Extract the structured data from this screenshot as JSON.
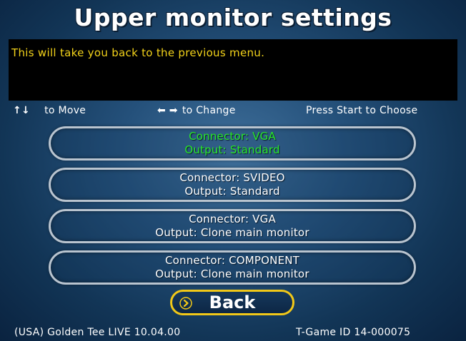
{
  "title": "Upper monitor settings",
  "help_text": "This will take you back to the previous menu.",
  "hints": {
    "move_arrows": "↑↓",
    "move_label": "to Move",
    "change_arrows": "⬅ ➡",
    "change_label": "to Change",
    "start_label": "Press Start to Choose"
  },
  "options": [
    {
      "line1": "Connector: VGA",
      "line2": "Output: Standard"
    },
    {
      "line1": "Connector: SVIDEO",
      "line2": "Output: Standard"
    },
    {
      "line1": "Connector: VGA",
      "line2": "Output: Clone main monitor"
    },
    {
      "line1": "Connector: COMPONENT",
      "line2": "Output: Clone main monitor"
    }
  ],
  "back": {
    "label": "Back",
    "icon": "chevron-right-icon"
  },
  "footer": {
    "left": "(USA) Golden Tee LIVE 10.04.00",
    "right": "T-Game ID 14-000075"
  },
  "colors": {
    "selected_text": "#28e62a",
    "help_text": "#f2d21a",
    "back_border": "#f2c818"
  }
}
